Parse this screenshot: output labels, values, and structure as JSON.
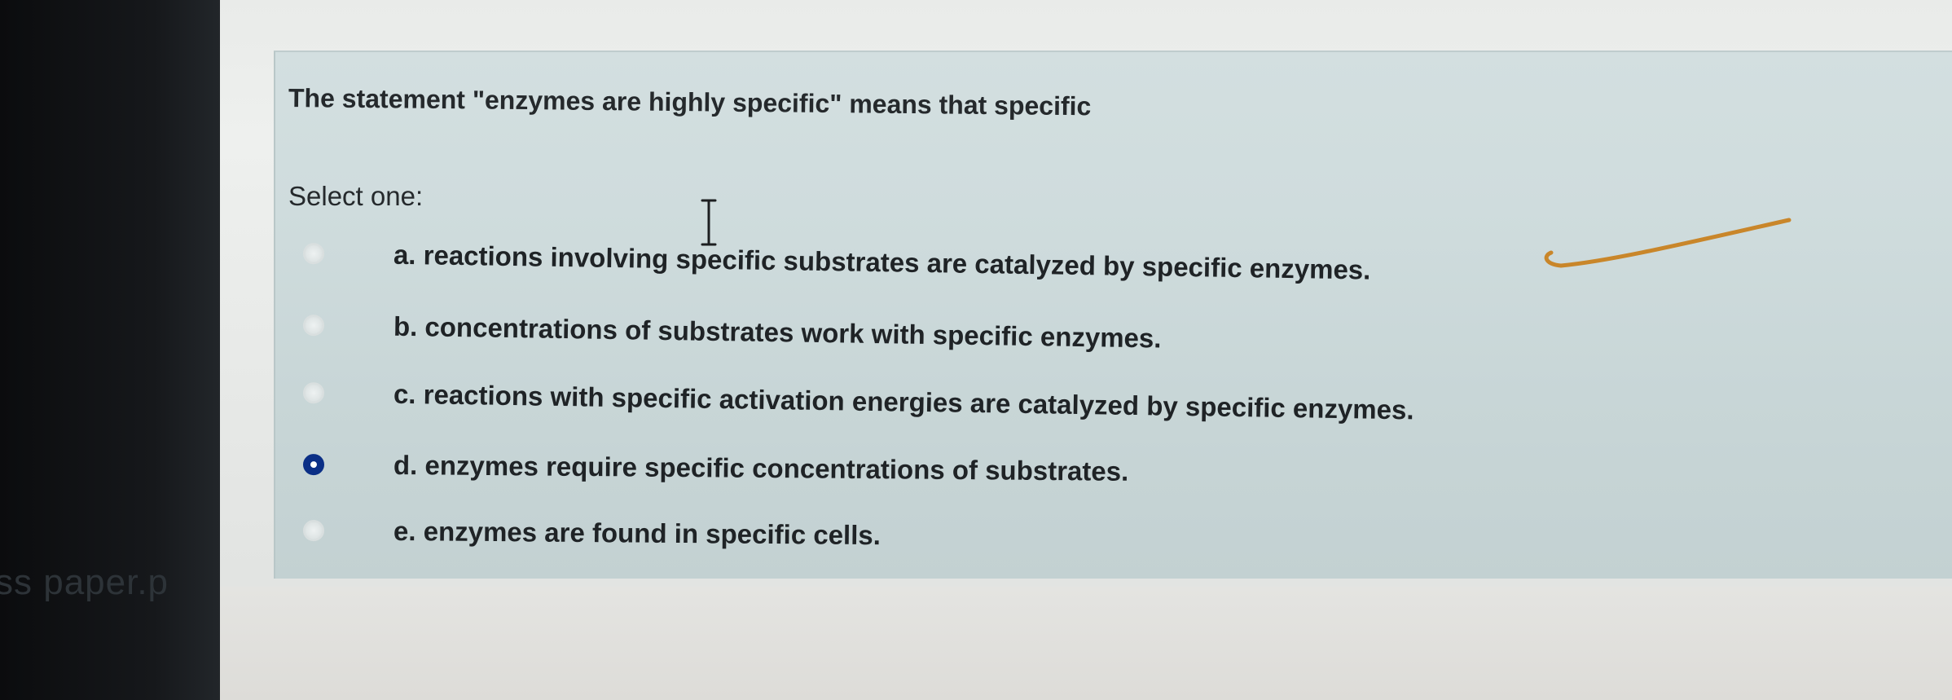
{
  "side_text": "ss paper.p",
  "question": {
    "prompt": "The statement \"enzymes are highly specific\" means that specific",
    "select_label": "Select one:",
    "options": [
      {
        "label": "a. reactions involving specific substrates are catalyzed by specific enzymes.",
        "selected": false
      },
      {
        "label": "b. concentrations of substrates work with specific enzymes.",
        "selected": false
      },
      {
        "label": "c. reactions with specific activation energies are catalyzed by specific enzymes.",
        "selected": false
      },
      {
        "label": "d. enzymes require specific concentrations of substrates.",
        "selected": true
      },
      {
        "label": "e. enzymes are found in specific cells.",
        "selected": false
      }
    ]
  },
  "colors": {
    "selected_radio": "#0b2f86",
    "annotation_pen": "#c9862a",
    "panel_bg": "#cfdcdd"
  },
  "icons": {
    "cursor": "text-ibeam-cursor",
    "annotation": "handwritten-check-stroke"
  }
}
